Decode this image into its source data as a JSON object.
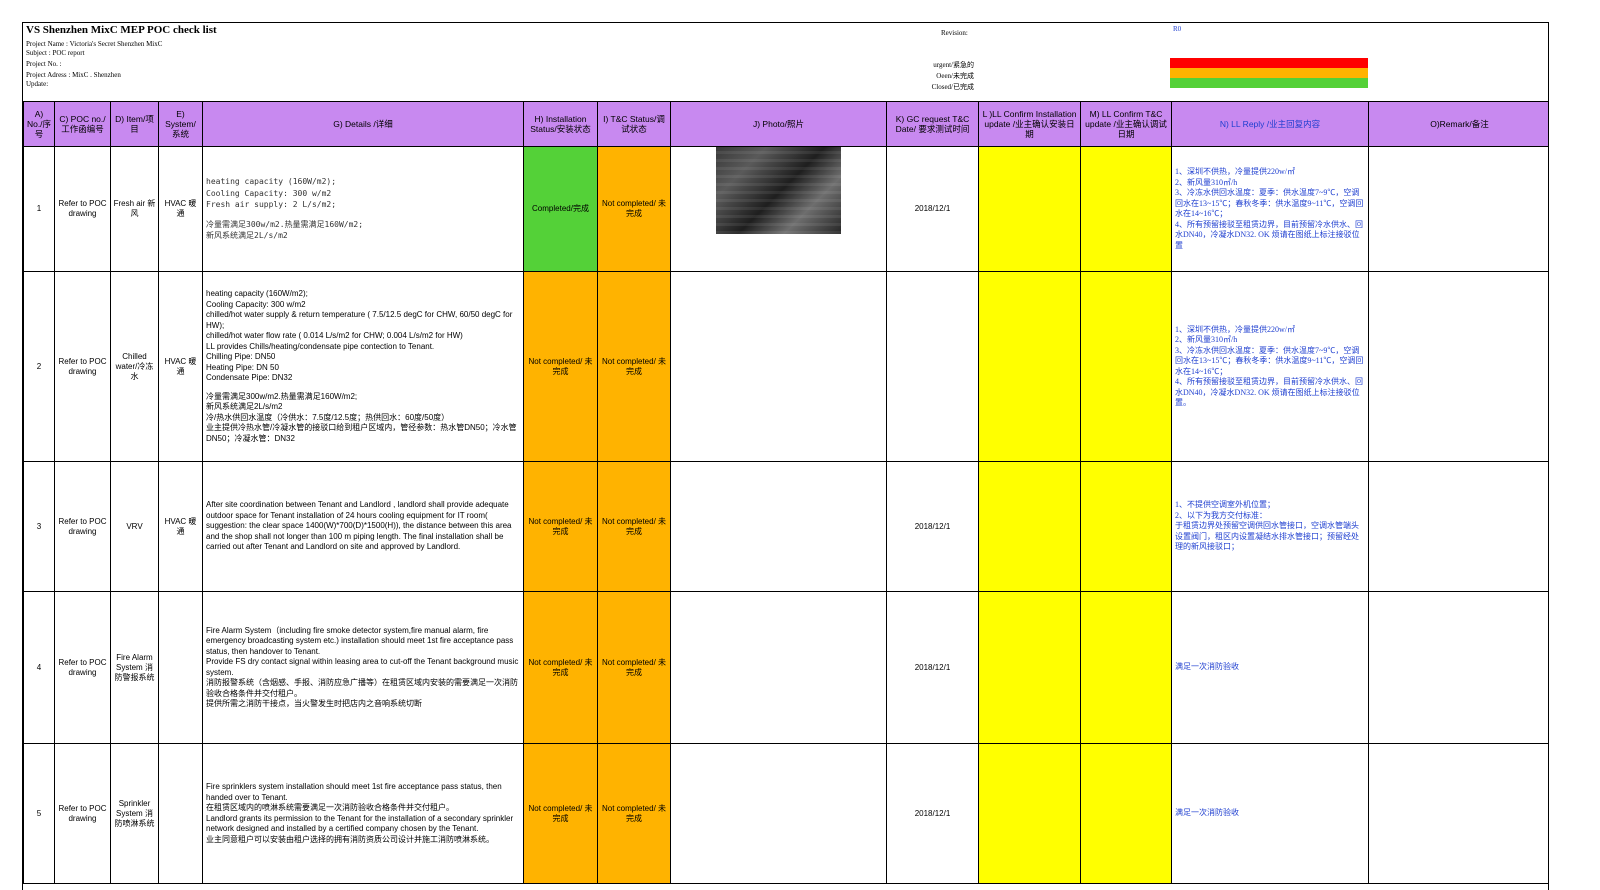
{
  "header": {
    "title": "VS Shenzhen MixC MEP POC  check list",
    "project_name": "Project Name :  Victoria's Secret Shenzhen MixC",
    "subject": "Subject : POC report",
    "project_no": "Project No. :",
    "project_address": "Project Adress :  MixC . Shenzhen",
    "update": "Update:",
    "revision_label": "Revision:",
    "revision_value": "R0",
    "legend": [
      {
        "label": "urgent/紧急的",
        "color": "#ff0000"
      },
      {
        "label": "Oeen/未完成",
        "color": "#ffb300"
      },
      {
        "label": "Closed/已完成",
        "color": "#54d138"
      }
    ]
  },
  "columns": [
    "A) No./序号",
    "C) POC no./工作函编号",
    "D) Item/项目",
    "E) System/系统",
    "G) Details /详细",
    "H) Installation Status/安装状态",
    "I)  T&C  Status/调试状态",
    "J) Photo/照片",
    "K) GC request T&C Date/  要求测试时间",
    "L )LL Confirm Installation update /业主确认安装日期",
    "M) LL Confirm T&C update /业主确认调试日期",
    "N) LL Reply  /业主回复内容",
    "O)Remark/备注"
  ],
  "rows": [
    {
      "no": "1",
      "poc": "Refer to POC drawing",
      "item": "Fresh air 新风",
      "system": "HVAC 暖通",
      "details": [
        "heating capacity (160W/m2);",
        "Cooling Capacity: 300 w/m2",
        "Fresh air supply: 2 L/s/m2;",
        "",
        "冷量需满足300w/m2.热量需满足160W/m2;",
        "新风系统满足2L/s/m2"
      ],
      "installation": "Completed/完成",
      "tc": "Not completed/ 未完成",
      "date": "2018/12/1",
      "reply": [
        "1、深圳不供热，冷量提供220w/㎡",
        "2、新风量310㎥/h",
        "3、冷冻水供回水温度：夏季：供水温度7~9℃，空调回水在13~15℃；春秋冬季：供水温度9~11℃，空调回水在14~16℃；",
        "4、所有预留接驳至租赁边界，目前预留冷水供水、回水DN40，冷凝水DN32.              OK  烦请在图纸上标注接驳位置"
      ]
    },
    {
      "no": "2",
      "poc": "Refer to POC drawing",
      "item": "Chilled water/冷冻水",
      "system": "HVAC 暖通",
      "details": [
        "heating capacity (160W/m2);",
        "Cooling Capacity: 300 w/m2",
        "chilled/hot water supply & return temperature ( 7.5/12.5 degC for CHW, 60/50 degC for HW);",
        "chilled/hot water flow rate ( 0.014 L/s/m2 for CHW; 0.004 L/s/m2 for HW)",
        "LL provides Chills/heating/condensate pipe contection to Tenant.",
        "Chilling Pipe: DN50",
        "Heating Pipe:  DN 50",
        "Condensate Pipe: DN32",
        "",
        "冷量需满足300w/m2.热量需满足160W/m2;",
        "新风系统满足2L/s/m2",
        "冷/热水供回水温度（冷供水：7.5度/12.5度；热供回水：60度/50度）",
        "业主提供冷热水管/冷凝水管的接驳口给到租户区域内，管径参数：热水管DN50；冷水管DN50；冷凝水管：DN32"
      ],
      "installation": "Not completed/ 未完成",
      "tc": "Not completed/ 未完成",
      "date": "",
      "reply": [
        "1、深圳不供热，冷量提供220w/㎡",
        "2、新风量310㎥/h",
        "3、冷冻水供回水温度：夏季：供水温度7~9℃，空调回水在13~15℃；春秋冬季：供水温度9~11℃，空调回水在14~16℃；",
        "4、所有预留接驳至租赁边界，目前预留冷水供水、回水DN40，冷凝水DN32.              OK  烦请在图纸上标注接驳位置。"
      ]
    },
    {
      "no": "3",
      "poc": "Refer to POC drawing",
      "item": "VRV",
      "system": "HVAC 暖通",
      "details": [
        "After site coordination between Tenant and Landlord , landlord shall provide adequate outdoor space for Tenant installation of 24 hours cooling equipment for IT room( suggestion: the clear space 1400(W)*700(D)*1500(H)), the distance between this area and the shop shall not longer than 100 m piping length. The final installation shall be carried out after Tenant and Landlord on site and approved by Landlord."
      ],
      "installation": "Not completed/ 未完成",
      "tc": "Not completed/ 未完成",
      "date": "2018/12/1",
      "reply": [
        "1、不提供空调室外机位置；",
        "2、以下为我方交付标准：",
        "于租赁边界处预留空调供回水管接口，空调水管端头设置阀门，租区内设置凝结水排水管接口；预留经处理的新风接驳口；"
      ]
    },
    {
      "no": "4",
      "poc": "Refer to POC drawing",
      "item": "Fire Alarm System 消防警报系统",
      "system": "",
      "details": [
        "Fire Alarm System（including fire smoke detector system,fire manual alarm, fire emergency broadcasting system etc.) installation should meet 1st fire acceptance pass status, then handover to Tenant.",
        "Provide FS dry contact signal within leasing area to cut-off the Tenant background music system.",
        "消防报警系统（含烟感、手报、消防应急广播等）在租赁区域内安装的需要满足一次消防验收合格条件并交付租户。",
        "提供所需之消防干接点，当火警发生时把店内之音响系统切断"
      ],
      "installation": "Not completed/ 未完成",
      "tc": "Not completed/ 未完成",
      "date": "2018/12/1",
      "reply": [
        "满足一次消防验收"
      ]
    },
    {
      "no": "5",
      "poc": "Refer to POC drawing",
      "item": "Sprinkler System 消防喷淋系统",
      "system": "",
      "details": [
        "Fire sprinklers system installation should meet 1st fire acceptance pass status, then handed over to Tenant.",
        "在租赁区域内的喷淋系统需要满足一次消防验收合格条件并交付租户。",
        "Landlord grants its permission to the Tenant for the installation of a secondary sprinkler network designed and installed by a certified company chosen by the Tenant.",
        "业主同意租户可以安装由租户选择的拥有消防资质公司设计并施工消防喷淋系统。"
      ],
      "installation": "Not completed/ 未完成",
      "tc": "Not completed/ 未完成",
      "date": "2018/12/1",
      "reply": [
        "满足一次消防验收"
      ]
    }
  ]
}
